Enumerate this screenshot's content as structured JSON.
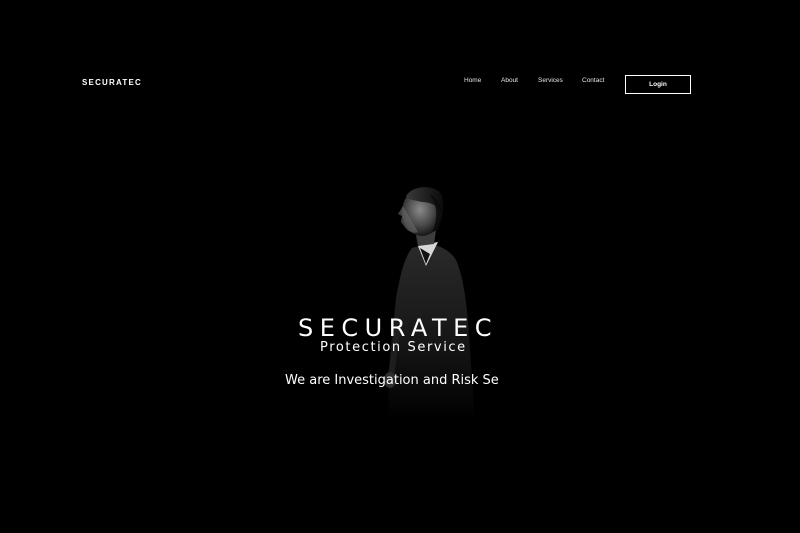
{
  "header": {
    "brand": "SECURATEC",
    "nav": {
      "home": "Home",
      "about": "About",
      "services": "Services",
      "contact": "Contact"
    },
    "login_label": "Login"
  },
  "hero": {
    "title": "SECURATEC",
    "subtitle": "Protection Service",
    "tagline": "We are Investigation and Risk Se"
  },
  "colors": {
    "background": "#000000",
    "text": "#ffffff"
  }
}
